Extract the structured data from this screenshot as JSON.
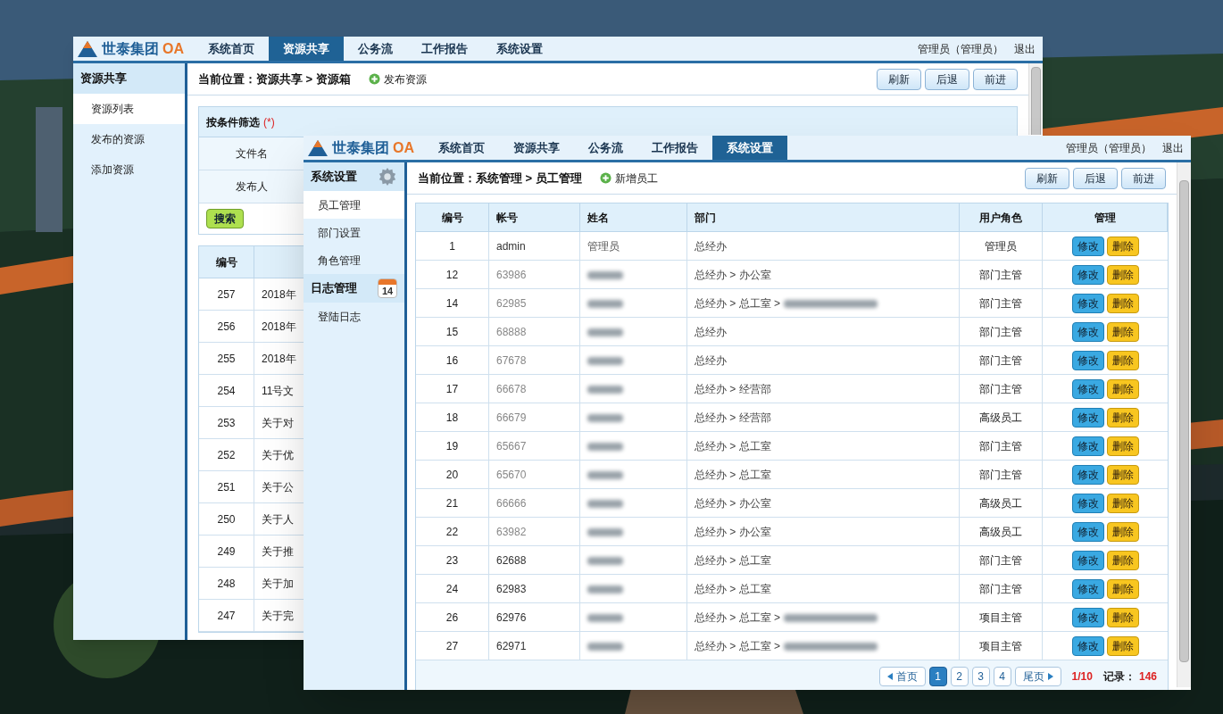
{
  "back_window": {
    "header": {
      "logo_name": "世泰集团",
      "logo_suffix": "OA",
      "tabs": [
        {
          "label": "系统首页",
          "selected": false
        },
        {
          "label": "资源共享",
          "selected": true
        },
        {
          "label": "公务流",
          "selected": false
        },
        {
          "label": "工作报告",
          "selected": false
        },
        {
          "label": "系统设置",
          "selected": false
        }
      ],
      "user": "管理员（管理员）",
      "logout": "退出"
    },
    "sidebar": {
      "title": "资源共享",
      "items": [
        {
          "label": "资源列表",
          "selected": true
        },
        {
          "label": "发布的资源",
          "selected": false
        },
        {
          "label": "添加资源",
          "selected": false
        }
      ]
    },
    "breadcrumb": "当前位置：资源共享 > 资源箱",
    "action": "发布资源",
    "buttons": [
      "刷新",
      "后退",
      "前进"
    ],
    "filter": {
      "title": "按条件筛选",
      "required_mark": "(*)",
      "fields": [
        "文件名",
        "发布人"
      ],
      "search_button": "搜索"
    },
    "table": {
      "columns": [
        "编号"
      ],
      "rows": [
        {
          "no": "257",
          "title": "2018年"
        },
        {
          "no": "256",
          "title": "2018年"
        },
        {
          "no": "255",
          "title": "2018年"
        },
        {
          "no": "254",
          "title": "11号文"
        },
        {
          "no": "253",
          "title": "关于对"
        },
        {
          "no": "252",
          "title": "关于优"
        },
        {
          "no": "251",
          "title": "关于公"
        },
        {
          "no": "250",
          "title": "关于人"
        },
        {
          "no": "249",
          "title": "关于推"
        },
        {
          "no": "248",
          "title": "关于加"
        },
        {
          "no": "247",
          "title": "关于完"
        }
      ]
    }
  },
  "front_window": {
    "header": {
      "logo_name": "世泰集团",
      "logo_suffix": "OA",
      "tabs": [
        {
          "label": "系统首页",
          "selected": false
        },
        {
          "label": "资源共享",
          "selected": false
        },
        {
          "label": "公务流",
          "selected": false
        },
        {
          "label": "工作报告",
          "selected": false
        },
        {
          "label": "系统设置",
          "selected": true
        }
      ],
      "user": "管理员（管理员）",
      "logout": "退出"
    },
    "sidebar": {
      "groups": [
        {
          "title": "系统设置",
          "kind": "gear",
          "items": [
            {
              "label": "员工管理",
              "selected": true
            },
            {
              "label": "部门设置",
              "selected": false
            },
            {
              "label": "角色管理",
              "selected": false
            }
          ]
        },
        {
          "title": "日志管理",
          "kind": "calendar",
          "badge": "14",
          "items": [
            {
              "label": "登陆日志",
              "selected": false
            }
          ]
        }
      ]
    },
    "breadcrumb": "当前位置：系统管理 > 员工管理",
    "action": "新增员工",
    "buttons": [
      "刷新",
      "后退",
      "前进"
    ],
    "table": {
      "columns": [
        "编号",
        "帐号",
        "姓名",
        "部门",
        "用户角色",
        "管理"
      ],
      "rows": [
        {
          "no": "1",
          "account": "admin",
          "account_blurred": false,
          "name": "管理员",
          "name_blurred": false,
          "dept": "总经办",
          "dept_tail_blurred": false,
          "role": "管理员",
          "edit": "修改",
          "delete": "删除"
        },
        {
          "no": "12",
          "account": "63986",
          "account_blurred": true,
          "name_blurred": true,
          "dept": "总经办 > 办公室",
          "dept_tail_blurred": false,
          "role": "部门主管",
          "edit": "修改",
          "delete": "删除"
        },
        {
          "no": "14",
          "account": "62985",
          "account_blurred": true,
          "name_blurred": true,
          "dept": "总经办 > 总工室 >",
          "dept_tail_blurred": true,
          "role": "部门主管",
          "edit": "修改",
          "delete": "删除"
        },
        {
          "no": "15",
          "account": "68888",
          "account_blurred": true,
          "name_blurred": true,
          "dept": "总经办",
          "dept_tail_blurred": false,
          "role": "部门主管",
          "edit": "修改",
          "delete": "删除"
        },
        {
          "no": "16",
          "account": "67678",
          "account_blurred": true,
          "name_blurred": true,
          "dept": "总经办",
          "dept_tail_blurred": false,
          "role": "部门主管",
          "edit": "修改",
          "delete": "删除"
        },
        {
          "no": "17",
          "account": "66678",
          "account_blurred": true,
          "name_blurred": true,
          "dept": "总经办 > 经营部",
          "dept_tail_blurred": false,
          "role": "部门主管",
          "edit": "修改",
          "delete": "删除"
        },
        {
          "no": "18",
          "account": "66679",
          "account_blurred": true,
          "name_blurred": true,
          "dept": "总经办 > 经营部",
          "dept_tail_blurred": false,
          "role": "高级员工",
          "edit": "修改",
          "delete": "删除"
        },
        {
          "no": "19",
          "account": "65667",
          "account_blurred": true,
          "name_blurred": true,
          "dept": "总经办 > 总工室",
          "dept_tail_blurred": false,
          "role": "部门主管",
          "edit": "修改",
          "delete": "删除"
        },
        {
          "no": "20",
          "account": "65670",
          "account_blurred": true,
          "name_blurred": true,
          "dept": "总经办 > 总工室",
          "dept_tail_blurred": false,
          "role": "部门主管",
          "edit": "修改",
          "delete": "删除"
        },
        {
          "no": "21",
          "account": "66666",
          "account_blurred": true,
          "name_blurred": true,
          "dept": "总经办 > 办公室",
          "dept_tail_blurred": false,
          "role": "高级员工",
          "edit": "修改",
          "delete": "删除"
        },
        {
          "no": "22",
          "account": "63982",
          "account_blurred": true,
          "name_blurred": true,
          "dept": "总经办 > 办公室",
          "dept_tail_blurred": false,
          "role": "高级员工",
          "edit": "修改",
          "delete": "删除"
        },
        {
          "no": "23",
          "account": "62688",
          "account_blurred": false,
          "name_blurred": true,
          "dept": "总经办 > 总工室",
          "dept_tail_blurred": false,
          "role": "部门主管",
          "edit": "修改",
          "delete": "删除"
        },
        {
          "no": "24",
          "account": "62983",
          "account_blurred": false,
          "name_blurred": true,
          "dept": "总经办 > 总工室",
          "dept_tail_blurred": false,
          "role": "部门主管",
          "edit": "修改",
          "delete": "删除"
        },
        {
          "no": "26",
          "account": "62976",
          "account_blurred": false,
          "name_blurred": true,
          "dept": "总经办 > 总工室 >",
          "dept_tail_blurred": true,
          "role": "项目主管",
          "edit": "修改",
          "delete": "删除"
        },
        {
          "no": "27",
          "account": "62971",
          "account_blurred": false,
          "name_blurred": true,
          "dept": "总经办 > 总工室 >",
          "dept_tail_blurred": true,
          "role": "项目主管",
          "edit": "修改",
          "delete": "删除"
        }
      ]
    },
    "pagination": {
      "first": "首页",
      "pages": [
        {
          "label": "1",
          "selected": true
        },
        {
          "label": "2",
          "selected": false
        },
        {
          "label": "3",
          "selected": false
        },
        {
          "label": "4",
          "selected": false
        }
      ],
      "last": "尾页",
      "page_info": "1/10",
      "records_label": "记录：",
      "records": "146"
    }
  }
}
